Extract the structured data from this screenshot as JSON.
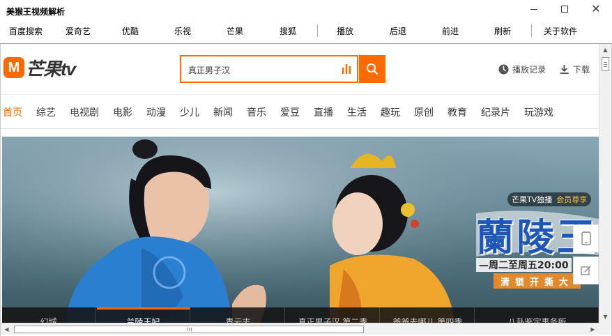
{
  "window": {
    "title": "美猴王视频解析",
    "minimize_label": "",
    "close_glyph": "✕"
  },
  "toolbar": {
    "items": [
      {
        "label": "百度搜索"
      },
      {
        "label": "爱奇艺"
      },
      {
        "label": "优酷"
      },
      {
        "label": "乐视"
      },
      {
        "label": "芒果"
      },
      {
        "label": "搜狐"
      },
      {
        "label": "播放"
      },
      {
        "label": "后退"
      },
      {
        "label": "前进"
      },
      {
        "label": "刷新"
      },
      {
        "label": "关于软件"
      }
    ]
  },
  "site": {
    "logo_mark": "M",
    "logo_text": "芒果tv",
    "search_value": "真正男子汉",
    "history_label": "播放记录",
    "download_label": "下载",
    "accent_color": "#ff6a00",
    "nav": [
      {
        "label": "首页",
        "active": true
      },
      {
        "label": "综艺"
      },
      {
        "label": "电视剧"
      },
      {
        "label": "电影"
      },
      {
        "label": "动漫"
      },
      {
        "label": "少儿"
      },
      {
        "label": "新闻"
      },
      {
        "label": "音乐"
      },
      {
        "label": "爱豆"
      },
      {
        "label": "直播"
      },
      {
        "label": "生活"
      },
      {
        "label": "趣玩"
      },
      {
        "label": "原创"
      },
      {
        "label": "教育"
      },
      {
        "label": "纪录片"
      },
      {
        "label": "玩游戏"
      }
    ]
  },
  "banner": {
    "exclusive_label": "芒果TV独播",
    "vip_label": "会员尊享",
    "show_title": "蘭陵王妃",
    "schedule": "—周二至周五20:00",
    "slogan": "清锁开撕大",
    "thumbs": [
      {
        "label": "幻城"
      },
      {
        "label": "兰陵王妃",
        "active": true
      },
      {
        "label": "青云志"
      },
      {
        "label": "真正男子汉 第二季"
      },
      {
        "label": "爸爸去哪儿 第四季"
      },
      {
        "label": "八卦鉴定事务所"
      }
    ]
  },
  "icons": {
    "search": "search-icon",
    "voice": "voice-bars-icon",
    "history": "clock-icon",
    "download": "download-icon",
    "phone": "phone-icon",
    "edit": "edit-icon"
  }
}
